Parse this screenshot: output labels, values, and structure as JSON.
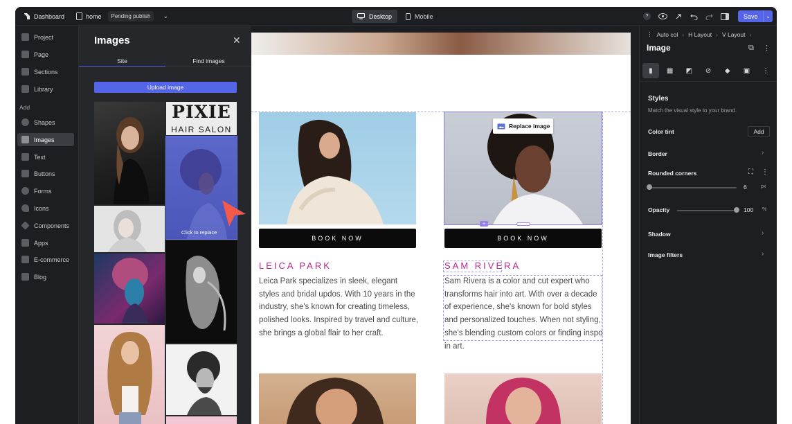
{
  "topbar": {
    "dashboard_label": "Dashboard",
    "page_name": "home",
    "status_badge": "Pending publish",
    "devices": [
      "Desktop",
      "Mobile"
    ],
    "active_device": "Desktop",
    "save_label": "Save",
    "help_label": "?"
  },
  "sidebar": {
    "items_top": [
      "Project",
      "Page",
      "Sections",
      "Library"
    ],
    "add_heading": "Add",
    "items_add": [
      "Shapes",
      "Images",
      "Text",
      "Buttons",
      "Forms",
      "Icons",
      "Components",
      "Apps",
      "E-commerce",
      "Blog"
    ],
    "active_item": "Images"
  },
  "images_panel": {
    "title": "Images",
    "tabs": [
      "Site",
      "Find images"
    ],
    "active_tab": "Site",
    "upload_label": "Upload image",
    "thumb_text_1": "PIXIE",
    "thumb_text_2": "HAIR SALON",
    "click_to_replace": "Click to replace"
  },
  "canvas": {
    "replace_image_label": "Replace image",
    "cards": [
      {
        "button": "BOOK NOW",
        "name": "LEICA PARK",
        "bio": "Leica Park specializes in sleek, elegant styles and bridal updos. With 10 years in the industry, she's known for creating timeless, polished looks. Inspired by travel and culture, she brings a global flair to her craft."
      },
      {
        "button": "BOOK NOW",
        "name": "SAM RIVERA",
        "bio": "Sam Rivera is a color and cut expert who transforms hair into art. With over a decade of experience, she's known for bold styles and personalized touches. When not styling, she's blending custom colors or finding inspo in art."
      }
    ]
  },
  "right_panel": {
    "breadcrumb": [
      "Auto col",
      "H Layout",
      "V Layout"
    ],
    "title": "Image",
    "styles_heading": "Styles",
    "styles_sub": "Match the visual style to your brand.",
    "color_tint_label": "Color tint",
    "add_label": "Add",
    "border_label": "Border",
    "rounded_corners_label": "Rounded corners",
    "rounded_corners_value": "6",
    "rounded_corners_unit": "px",
    "rounded_corners_fraction": 0.0,
    "opacity_label": "Opacity",
    "opacity_value": "100",
    "opacity_unit": "%",
    "opacity_fraction": 1.0,
    "shadow_label": "Shadow",
    "image_filters_label": "Image filters"
  },
  "colors": {
    "accent": "#5465e8",
    "name_pink": "#b8278e",
    "selection": "#8a78e6",
    "arrow": "#f25a4b"
  }
}
